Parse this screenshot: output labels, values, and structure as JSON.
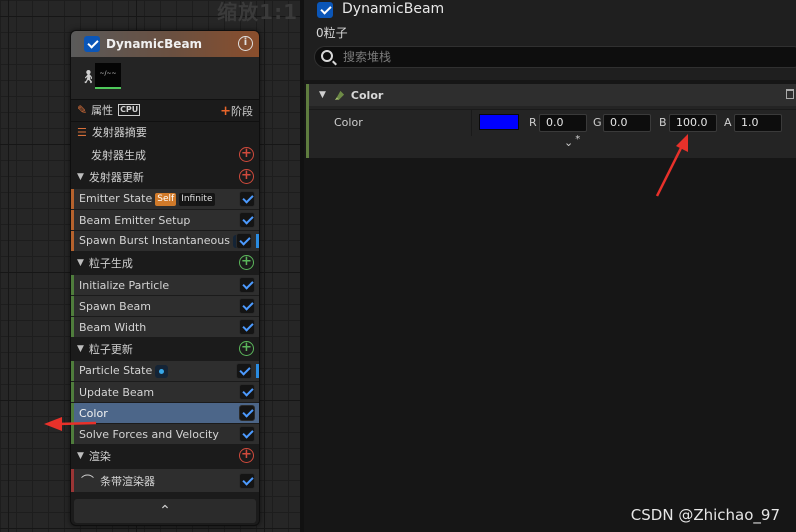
{
  "graph": {
    "zoom_label": "缩放1:1"
  },
  "node": {
    "title": "DynamicBeam",
    "info_icon": "i",
    "preview_glyph": "~/~~",
    "properties_label": "属性",
    "cpu_label": "CPU",
    "stage_label": "阶段",
    "emitter_summary_label": "发射器摘要",
    "footer_glyph": "⌃",
    "sections": [
      {
        "label": "发射器生成",
        "collapsible": false,
        "add_color": "red",
        "items": []
      },
      {
        "label": "发射器更新",
        "collapsible": true,
        "add_color": "red",
        "items": [
          {
            "label": "Emitter State",
            "badges": [
              "Self",
              "Infinite"
            ],
            "checked": true,
            "dot": false
          },
          {
            "label": "Beam Emitter Setup",
            "badges": [],
            "checked": true,
            "dot": false
          },
          {
            "label": "Spawn Burst Instantaneous",
            "badges": [],
            "checked": true,
            "dot": true
          }
        ]
      },
      {
        "label": "粒子生成",
        "collapsible": true,
        "add_color": "green",
        "items": [
          {
            "label": "Initialize Particle",
            "badges": [],
            "checked": true,
            "dot": false
          },
          {
            "label": "Spawn Beam",
            "badges": [],
            "checked": true,
            "dot": false
          },
          {
            "label": "Beam Width",
            "badges": [],
            "checked": true,
            "dot": false
          }
        ]
      },
      {
        "label": "粒子更新",
        "collapsible": true,
        "add_color": "green",
        "items": [
          {
            "label": "Particle State",
            "badges": [],
            "checked": true,
            "dot": true
          },
          {
            "label": "Update Beam",
            "badges": [],
            "checked": true,
            "dot": false
          },
          {
            "label": "Color",
            "badges": [],
            "checked": true,
            "dot": false,
            "selected": true
          },
          {
            "label": "Solve Forces and Velocity",
            "badges": [],
            "checked": true,
            "dot": false
          }
        ]
      },
      {
        "label": "渲染",
        "collapsible": true,
        "add_color": "red",
        "items": [
          {
            "label": "条带渲染器",
            "badges": [],
            "checked": true,
            "dot": false,
            "renderer": true
          }
        ]
      }
    ]
  },
  "details": {
    "emitter_name": "DynamicBeam",
    "particle_count": "0粒子",
    "search_placeholder": "搜索堆栈",
    "category_label": "Color",
    "property_label": "Color",
    "swatch_color": "#0000ff",
    "channels": [
      {
        "label": "R",
        "value": "0.0"
      },
      {
        "label": "G",
        "value": "0.0"
      },
      {
        "label": "B",
        "value": "100.0"
      },
      {
        "label": "A",
        "value": "1.0"
      }
    ],
    "expand_glyph": "⌄",
    "modified_marker": "*"
  },
  "watermark": "CSDN @Zhichao_97",
  "accent_colors": {
    "checkbox": "#0b56b8",
    "selected_row": "#4c6689",
    "arrow": "#e8312a"
  }
}
